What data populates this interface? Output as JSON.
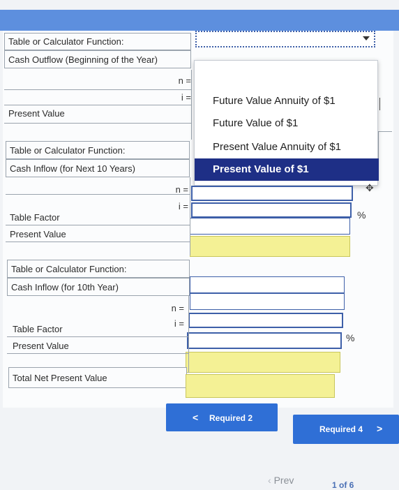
{
  "section1": {
    "function_label": "Table or Calculator Function:",
    "flow_label": "Cash Outflow (Beginning of the Year)",
    "n_label": "n =",
    "i_label": "i =",
    "pv_label": "Present Value"
  },
  "dropdown": {
    "options": [
      "Future Value Annuity of $1",
      "Future Value of $1",
      "Present Value Annuity of $1",
      "Present Value of $1"
    ],
    "selected_index": 3
  },
  "section2": {
    "function_label": "Table or Calculator Function:",
    "flow_label": "Cash Inflow (for Next 10 Years)",
    "n_label": "n =",
    "i_label": "i =",
    "pct": "%",
    "factor_label": "Table Factor",
    "pv_label": "Present Value"
  },
  "section3": {
    "function_label": "Table or Calculator Function:",
    "flow_label": "Cash Inflow (for 10th Year)",
    "n_label": "n =",
    "i_label": "i =",
    "pct": "%",
    "factor_label": "Table Factor",
    "pv_label": "Present Value"
  },
  "total_label": "Total Net Present Value",
  "nav": {
    "prev_required": "Required 2",
    "next_required": "Required 4",
    "prev_arrow": "<",
    "next_arrow": ">",
    "prev": "Prev",
    "page": "1 of 6"
  }
}
